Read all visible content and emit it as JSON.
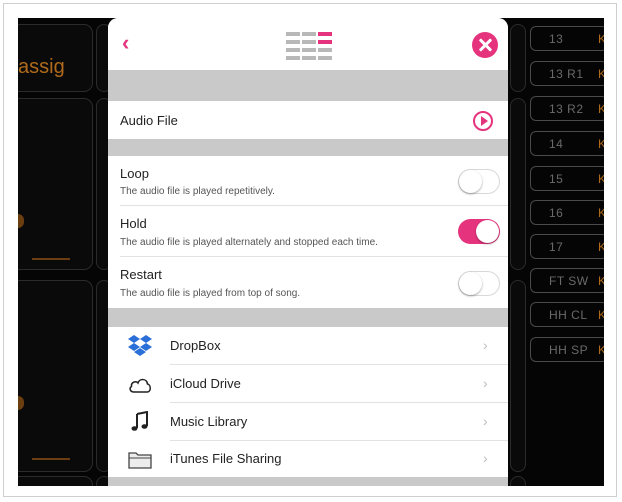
{
  "background": {
    "assign_text": "assig",
    "right_buttons": [
      {
        "name": "13",
        "kit": "Ki"
      },
      {
        "name": "13 R1",
        "kit": "Ki"
      },
      {
        "name": "13 R2",
        "kit": "Ki"
      },
      {
        "name": "14",
        "kit": "Ki"
      },
      {
        "name": "15",
        "kit": "Ki"
      },
      {
        "name": "16",
        "kit": "Ki"
      },
      {
        "name": "17",
        "kit": "Ki"
      },
      {
        "name": "FT SW",
        "kit": "Ki"
      },
      {
        "name": "HH CL",
        "kit": "Ki"
      },
      {
        "name": "HH SP",
        "kit": "Ki"
      }
    ]
  },
  "modal": {
    "back_glyph": "‹",
    "audio_file": {
      "label": "Audio File"
    },
    "options": [
      {
        "title": "Loop",
        "desc": "The audio file is played repetitively.",
        "on": false
      },
      {
        "title": "Hold",
        "desc": "The audio file is played alternately and stopped each time.",
        "on": true
      },
      {
        "title": "Restart",
        "desc": "The audio file is played from top of song.",
        "on": false
      }
    ],
    "sources": [
      {
        "label": "DropBox",
        "icon": "dropbox-icon"
      },
      {
        "label": "iCloud Drive",
        "icon": "cloud-icon"
      },
      {
        "label": "Music Library",
        "icon": "music-note-icon"
      },
      {
        "label": "iTunes File Sharing",
        "icon": "folder-icon"
      }
    ],
    "chevron": "›"
  },
  "colors": {
    "accent": "#e6337d",
    "background": "#050505",
    "separator": "#c9c9c9",
    "kit_orange": "#b06a1a"
  }
}
